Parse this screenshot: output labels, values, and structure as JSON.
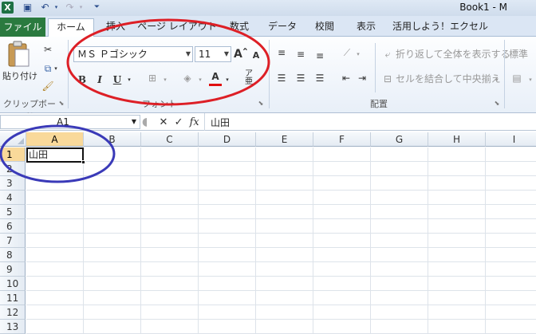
{
  "window": {
    "title": "Book1 - M",
    "app_icon": "X"
  },
  "tabs": [
    "ファイル",
    "ホーム",
    "挿入",
    "ページ レイアウト",
    "数式",
    "データ",
    "校閲",
    "表示",
    "活用しよう！エクセル"
  ],
  "ribbon": {
    "clipboard": {
      "paste_label": "貼り付け",
      "group_label": "クリップボード"
    },
    "font": {
      "font_name": "ＭＳ Ｐゴシック",
      "font_size": "11",
      "bold": "B",
      "italic": "I",
      "underline": "U",
      "group_label": "フォント"
    },
    "alignment": {
      "wrap_text": "折り返して全体を表示する",
      "merge_center": "セルを結合して中央揃え",
      "group_label": "配置"
    },
    "number": {
      "format": "標準"
    }
  },
  "formula_bar": {
    "name_box": "A1",
    "fx": "fx",
    "content": "山田"
  },
  "sheet": {
    "columns": [
      "A",
      "B",
      "C",
      "D",
      "E",
      "F",
      "G",
      "H",
      "I"
    ],
    "rows": [
      "1",
      "2",
      "3",
      "4",
      "5",
      "6",
      "7",
      "8",
      "9",
      "10",
      "11",
      "12",
      "13"
    ],
    "cells": {
      "A1": "山田"
    },
    "selected_cell": "A1"
  },
  "annotations": {
    "colors": [
      "#dd1f26",
      "#3a3ab8"
    ]
  }
}
